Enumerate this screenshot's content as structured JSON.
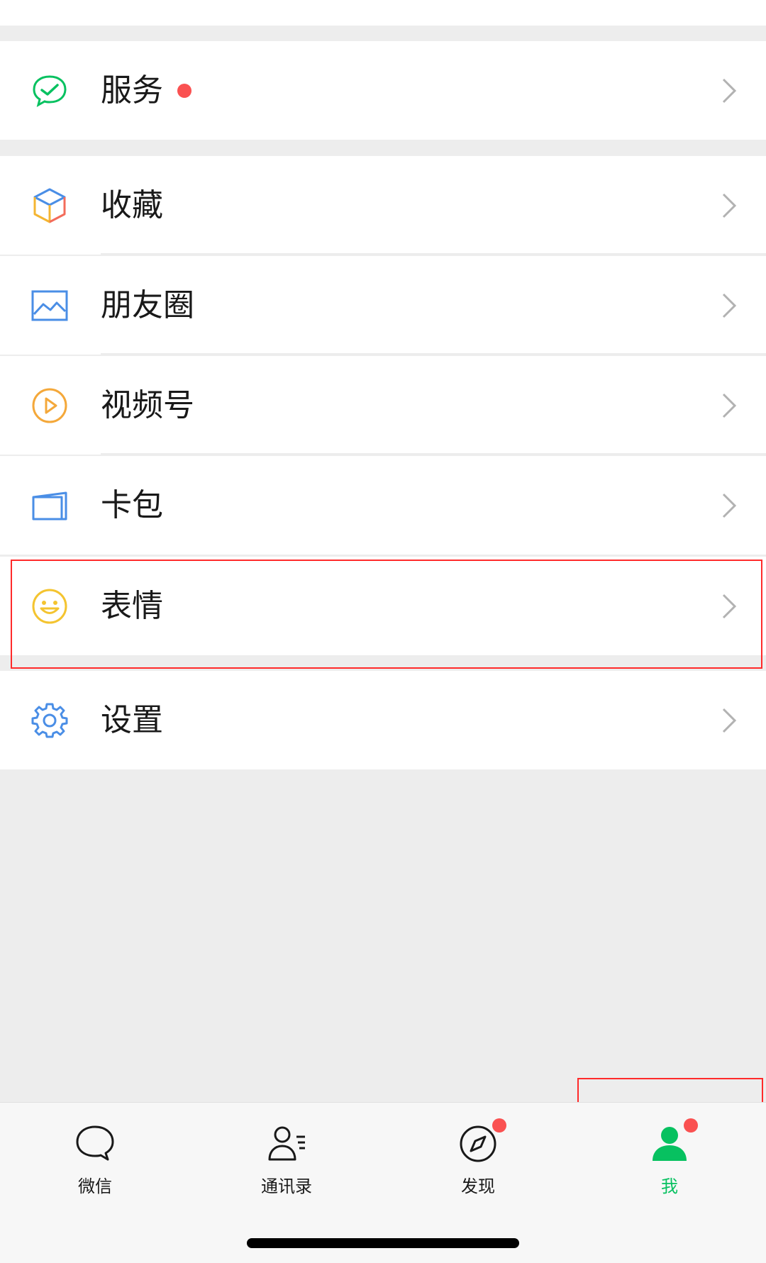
{
  "menu": {
    "services": {
      "label": "服务",
      "has_dot": true
    },
    "favorites": {
      "label": "收藏"
    },
    "moments": {
      "label": "朋友圈"
    },
    "channels": {
      "label": "视频号"
    },
    "cards": {
      "label": "卡包"
    },
    "stickers": {
      "label": "表情"
    },
    "settings": {
      "label": "设置"
    }
  },
  "tabbar": {
    "tabs": [
      {
        "label": "微信",
        "icon": "chat-bubble-icon",
        "active": false,
        "badge": false
      },
      {
        "label": "通讯录",
        "icon": "contacts-icon",
        "active": false,
        "badge": false
      },
      {
        "label": "发现",
        "icon": "compass-icon",
        "active": false,
        "badge": true
      },
      {
        "label": "我",
        "icon": "person-icon",
        "active": true,
        "badge": true
      }
    ]
  },
  "colors": {
    "accent_green": "#07c160",
    "badge_red": "#fa5151",
    "highlight_red": "#ff2a2a",
    "text": "#191919",
    "background": "#ededed"
  }
}
